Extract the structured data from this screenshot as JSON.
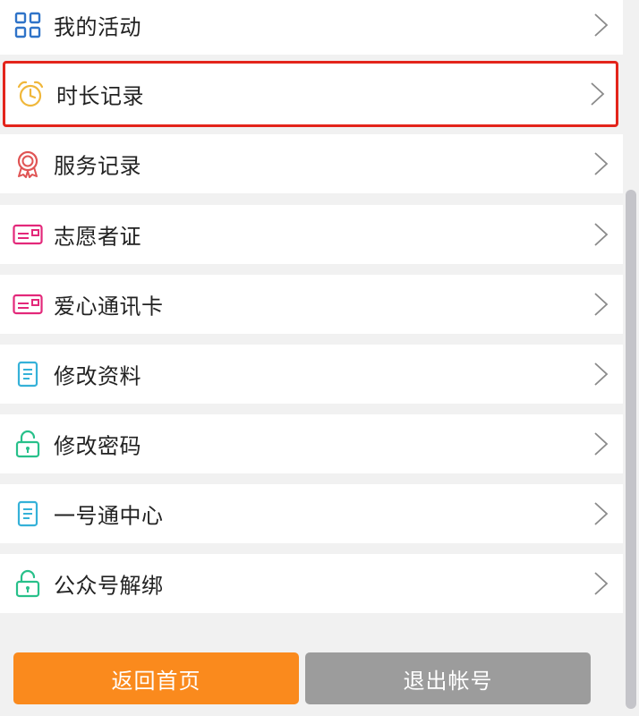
{
  "menu": {
    "items": [
      {
        "label": "我的活动",
        "icon": "grid-icon",
        "icon_color": "#2f73c8"
      },
      {
        "label": "时长记录",
        "icon": "alarm-clock-icon",
        "icon_color": "#f0b73a",
        "highlighted": true
      },
      {
        "label": "服务记录",
        "icon": "award-ribbon-icon",
        "icon_color": "#e05454"
      },
      {
        "label": "志愿者证",
        "icon": "card-icon",
        "icon_color": "#e3287a"
      },
      {
        "label": "爱心通讯卡",
        "icon": "card-icon",
        "icon_color": "#e3287a"
      },
      {
        "label": "修改资料",
        "icon": "document-icon",
        "icon_color": "#35b1d8"
      },
      {
        "label": "修改密码",
        "icon": "unlock-icon",
        "icon_color": "#28c08a"
      },
      {
        "label": "一号通中心",
        "icon": "document-icon",
        "icon_color": "#35b1d8"
      },
      {
        "label": "公众号解绑",
        "icon": "unlock-icon",
        "icon_color": "#28c08a"
      }
    ]
  },
  "footer": {
    "home_label": "返回首页",
    "logout_label": "退出帐号"
  },
  "colors": {
    "highlight_border": "#e3241b",
    "home_button": "#fa8a1d",
    "logout_button": "#9c9c9c",
    "chevron": "#8a8a8a"
  }
}
